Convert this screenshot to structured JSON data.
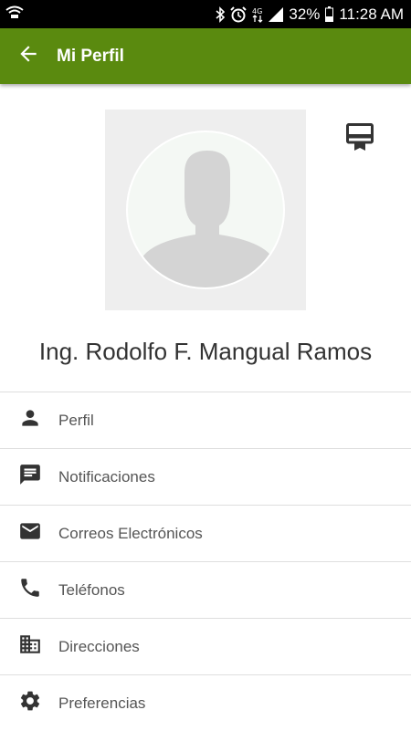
{
  "status_bar": {
    "battery": "32%",
    "time": "11:28 AM"
  },
  "app_bar": {
    "title": "Mi Perfil"
  },
  "profile": {
    "name": "Ing. Rodolfo F. Mangual Ramos"
  },
  "menu": {
    "items": [
      {
        "label": "Perfil",
        "icon": "person-icon"
      },
      {
        "label": "Notificaciones",
        "icon": "chat-icon"
      },
      {
        "label": "Correos Electrónicos",
        "icon": "mail-icon"
      },
      {
        "label": "Teléfonos",
        "icon": "phone-icon"
      },
      {
        "label": "Direcciones",
        "icon": "building-icon"
      },
      {
        "label": "Preferencias",
        "icon": "gear-icon"
      }
    ]
  },
  "colors": {
    "app_bar": "#5a8a0f",
    "status_bar": "#000000"
  }
}
